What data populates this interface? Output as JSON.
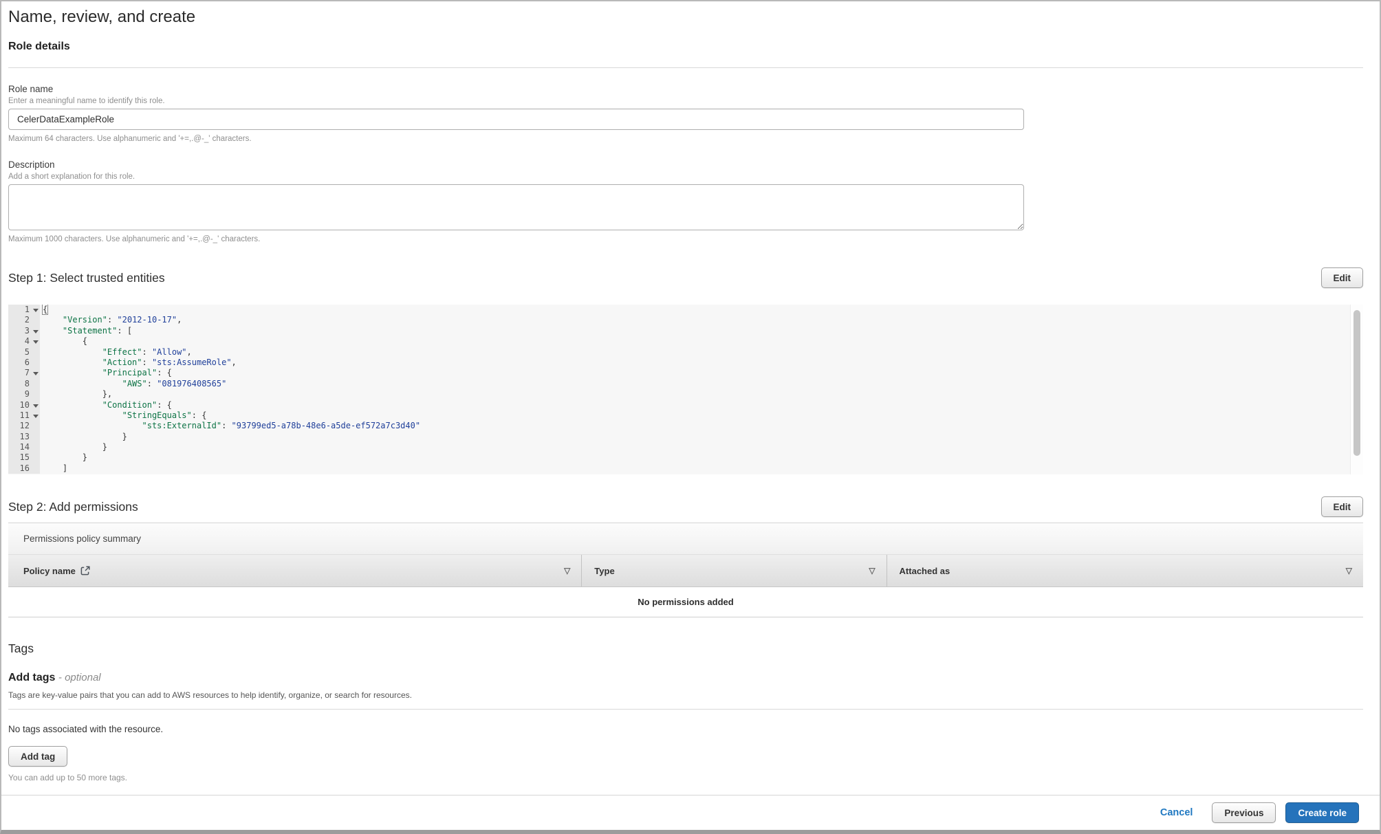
{
  "colors": {
    "primary_button": "#2573bb",
    "link": "#1f78c1",
    "code_key": "#0c7345",
    "code_value": "#20409a"
  },
  "icons": {
    "sort": "▽"
  },
  "page": {
    "title": "Name, review, and create"
  },
  "role_details": {
    "heading": "Role details",
    "role_name_label": "Role name",
    "role_name_help": "Enter a meaningful name to identify this role.",
    "role_name_value": "CelerDataExampleRole",
    "role_name_constraint": "Maximum 64 characters. Use alphanumeric and '+=,.@-_' characters.",
    "description_label": "Description",
    "description_help": "Add a short explanation for this role.",
    "description_value": "",
    "description_constraint": "Maximum 1000 characters. Use alphanumeric and '+=,.@-_' characters."
  },
  "step1": {
    "heading": "Step 1: Select trusted entities",
    "edit_label": "Edit",
    "policy_lines": [
      {
        "num": "1",
        "fold": true,
        "cursor": true,
        "pre": "{"
      },
      {
        "num": "2",
        "pre": "    ",
        "key": "\"Version\"",
        "mid": ": ",
        "val": "\"2012-10-17\"",
        "post": ","
      },
      {
        "num": "3",
        "fold": true,
        "pre": "    ",
        "key": "\"Statement\"",
        "mid": ": ",
        "post": "["
      },
      {
        "num": "4",
        "fold": true,
        "pre": "        {"
      },
      {
        "num": "5",
        "pre": "            ",
        "key": "\"Effect\"",
        "mid": ": ",
        "val": "\"Allow\"",
        "post": ","
      },
      {
        "num": "6",
        "pre": "            ",
        "key": "\"Action\"",
        "mid": ": ",
        "val": "\"sts:AssumeRole\"",
        "post": ","
      },
      {
        "num": "7",
        "fold": true,
        "pre": "            ",
        "key": "\"Principal\"",
        "mid": ": ",
        "post": "{"
      },
      {
        "num": "8",
        "pre": "                ",
        "key": "\"AWS\"",
        "mid": ": ",
        "val": "\"081976408565\""
      },
      {
        "num": "9",
        "pre": "            },"
      },
      {
        "num": "10",
        "fold": true,
        "pre": "            ",
        "key": "\"Condition\"",
        "mid": ": ",
        "post": "{"
      },
      {
        "num": "11",
        "fold": true,
        "pre": "                ",
        "key": "\"StringEquals\"",
        "mid": ": ",
        "post": "{"
      },
      {
        "num": "12",
        "pre": "                    ",
        "key": "\"sts:ExternalId\"",
        "mid": ": ",
        "val": "\"93799ed5-a78b-48e6-a5de-ef572a7c3d40\""
      },
      {
        "num": "13",
        "pre": "                }"
      },
      {
        "num": "14",
        "pre": "            }"
      },
      {
        "num": "15",
        "pre": "        }"
      },
      {
        "num": "16",
        "pre": "    ]"
      }
    ]
  },
  "step2": {
    "heading": "Step 2: Add permissions",
    "edit_label": "Edit",
    "panel_title": "Permissions policy summary",
    "columns": [
      "Policy name",
      "Type",
      "Attached as"
    ],
    "empty_message": "No permissions added"
  },
  "tags": {
    "heading": "Tags",
    "subheading": "Add tags",
    "subheading_suffix": "- optional",
    "description": "Tags are key-value pairs that you can add to AWS resources to help identify, organize, or search for resources.",
    "empty_message": "No tags associated with the resource.",
    "add_button": "Add tag",
    "limit_note": "You can add up to 50 more tags."
  },
  "footer": {
    "cancel": "Cancel",
    "previous": "Previous",
    "create": "Create role"
  }
}
